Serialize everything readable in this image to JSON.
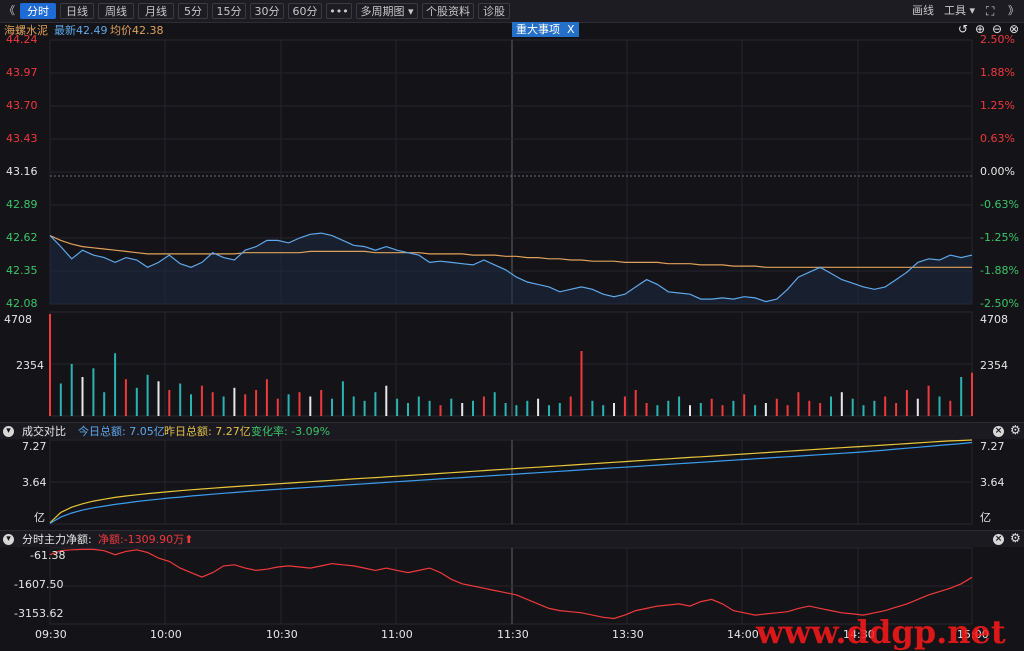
{
  "toolbar": {
    "nav_back": "《",
    "nav_forward": "》",
    "tabs": [
      "分时",
      "日线",
      "周线",
      "月线",
      "5分",
      "15分",
      "30分",
      "60分",
      "•••",
      "多周期图",
      "个股资料",
      "诊股"
    ],
    "active_tab": "分时",
    "draw_label": "画线",
    "tools_label": "工具"
  },
  "stock": {
    "name": "海螺水泥",
    "latest_label": "最新42.49",
    "avg_label": "均价42.38",
    "event_label": "重大事项",
    "event_close": "X"
  },
  "price_axis": {
    "left": [
      "44.24",
      "43.97",
      "43.70",
      "43.43",
      "43.16",
      "42.89",
      "42.62",
      "42.35",
      "42.08"
    ],
    "right": [
      "2.50%",
      "1.88%",
      "1.25%",
      "0.63%",
      "0.00%",
      "-0.63%",
      "-1.25%",
      "-1.88%",
      "-2.50%"
    ]
  },
  "volume_axis": {
    "top": "4708",
    "mid": "2354"
  },
  "turnover_panel": {
    "title": "成交对比",
    "today_label": "今日总额: 7.05亿",
    "yesterday_label": "昨日总额: 7.27亿",
    "change_label": "变化率: -3.09%",
    "axis": [
      "7.27",
      "3.64",
      "亿"
    ]
  },
  "netflow_panel": {
    "title": "分时主力净额:",
    "net_label": "净额:-1309.90万",
    "axis": [
      "-61.38",
      "-1607.50",
      "-3153.62"
    ]
  },
  "time_axis": [
    "09:30",
    "10:00",
    "10:30",
    "11:00",
    "11:30",
    "13:30",
    "14:00",
    "14:30",
    "15:00"
  ],
  "watermark": "www.ddgp.net",
  "colors": {
    "price_line": "#5fa8ea",
    "avg_line": "#e0a25a",
    "up": "#f0393c",
    "down": "#2bb3b3",
    "today_line": "#3a9ef0",
    "yesterday_line": "#e8c63a",
    "netflow_line": "#f0393c"
  },
  "chart_data": {
    "type": "line",
    "price": {
      "prev_close": 43.16,
      "ylim": [
        42.08,
        44.24
      ],
      "values": [
        42.64,
        42.55,
        42.45,
        42.52,
        42.48,
        42.46,
        42.42,
        42.46,
        42.44,
        42.38,
        42.42,
        42.48,
        42.41,
        42.38,
        42.42,
        42.5,
        42.46,
        42.44,
        42.52,
        42.55,
        42.6,
        42.6,
        42.58,
        42.62,
        42.65,
        42.66,
        42.64,
        42.6,
        42.56,
        42.55,
        42.52,
        42.55,
        42.52,
        42.5,
        42.48,
        42.42,
        42.43,
        42.42,
        42.41,
        42.4,
        42.44,
        42.4,
        42.36,
        42.3,
        42.26,
        42.24,
        42.22,
        42.18,
        42.2,
        42.22,
        42.2,
        42.16,
        42.14,
        42.16,
        42.22,
        42.28,
        42.24,
        42.18,
        42.17,
        42.16,
        42.12,
        42.12,
        42.13,
        42.12,
        42.14,
        42.13,
        42.1,
        42.12,
        42.2,
        42.3,
        42.34,
        42.38,
        42.33,
        42.28,
        42.25,
        42.22,
        42.2,
        42.22,
        42.28,
        42.34,
        42.42,
        42.45,
        42.44,
        42.48,
        42.46,
        42.48
      ],
      "avg": [
        42.64,
        42.6,
        42.57,
        42.55,
        42.54,
        42.53,
        42.52,
        42.51,
        42.5,
        42.49,
        42.49,
        42.49,
        42.49,
        42.49,
        42.49,
        42.49,
        42.49,
        42.49,
        42.5,
        42.5,
        42.5,
        42.5,
        42.5,
        42.5,
        42.51,
        42.51,
        42.51,
        42.51,
        42.51,
        42.51,
        42.5,
        42.5,
        42.5,
        42.5,
        42.5,
        42.49,
        42.49,
        42.49,
        42.49,
        42.48,
        42.48,
        42.48,
        42.47,
        42.47,
        42.46,
        42.46,
        42.45,
        42.45,
        42.44,
        42.44,
        42.43,
        42.43,
        42.43,
        42.42,
        42.42,
        42.42,
        42.42,
        42.41,
        42.41,
        42.41,
        42.4,
        42.4,
        42.4,
        42.39,
        42.39,
        42.39,
        42.38,
        42.38,
        42.38,
        42.38,
        42.38,
        42.38,
        42.38,
        42.38,
        42.38,
        42.38,
        42.38,
        42.38,
        42.38,
        42.38,
        42.38,
        42.38,
        42.38,
        42.38,
        42.38,
        42.38
      ]
    },
    "volume": {
      "ylim": [
        0,
        4708
      ],
      "values": [
        4708,
        1500,
        2400,
        1800,
        2200,
        1100,
        2900,
        1700,
        1300,
        1900,
        1600,
        1200,
        1500,
        1000,
        1400,
        1100,
        900,
        1300,
        1000,
        1200,
        1700,
        800,
        1000,
        1100,
        900,
        1200,
        800,
        1600,
        900,
        700,
        1100,
        1400,
        800,
        600,
        900,
        700,
        500,
        800,
        600,
        700,
        900,
        1100,
        600,
        500,
        700,
        800,
        500,
        600,
        900,
        3000,
        700,
        500,
        600,
        900,
        1200,
        600,
        500,
        700,
        900,
        500,
        600,
        800,
        500,
        700,
        1000,
        500,
        600,
        800,
        500,
        1100,
        700,
        600,
        900,
        1100,
        800,
        500,
        700,
        900,
        600,
        1200,
        800,
        1400,
        900,
        700,
        1800,
        2000
      ]
    },
    "turnover": {
      "ylim": [
        0,
        7.27
      ],
      "today": [
        0.05,
        0.6,
        0.95,
        1.2,
        1.4,
        1.55,
        1.7,
        1.82,
        1.95,
        2.05,
        2.15,
        2.25,
        2.33,
        2.42,
        2.5,
        2.58,
        2.66,
        2.73,
        2.8,
        2.87,
        2.94,
        3.0,
        3.06,
        3.12,
        3.18,
        3.24,
        3.3,
        3.36,
        3.42,
        3.48,
        3.54,
        3.6,
        3.66,
        3.72,
        3.78,
        3.84,
        3.9,
        3.96,
        4.02,
        4.08,
        4.14,
        4.2,
        4.26,
        4.32,
        4.38,
        4.44,
        4.5,
        4.56,
        4.62,
        4.68,
        4.74,
        4.8,
        4.86,
        4.92,
        4.98,
        5.04,
        5.1,
        5.16,
        5.22,
        5.28,
        5.34,
        5.4,
        5.46,
        5.52,
        5.58,
        5.64,
        5.7,
        5.76,
        5.82,
        5.88,
        5.94,
        6.0,
        6.06,
        6.12,
        6.18,
        6.24,
        6.32,
        6.4,
        6.48,
        6.56,
        6.64,
        6.72,
        6.8,
        6.88,
        6.96,
        7.05
      ],
      "yesterday": [
        0.1,
        1.0,
        1.45,
        1.75,
        1.98,
        2.15,
        2.3,
        2.42,
        2.53,
        2.63,
        2.72,
        2.8,
        2.88,
        2.96,
        3.03,
        3.1,
        3.17,
        3.24,
        3.3,
        3.36,
        3.42,
        3.48,
        3.54,
        3.6,
        3.66,
        3.72,
        3.78,
        3.84,
        3.9,
        3.96,
        4.02,
        4.08,
        4.14,
        4.2,
        4.26,
        4.32,
        4.38,
        4.44,
        4.5,
        4.56,
        4.62,
        4.68,
        4.74,
        4.8,
        4.86,
        4.92,
        4.98,
        5.04,
        5.1,
        5.16,
        5.22,
        5.28,
        5.34,
        5.4,
        5.46,
        5.52,
        5.58,
        5.64,
        5.7,
        5.76,
        5.82,
        5.88,
        5.94,
        6.0,
        6.06,
        6.12,
        6.18,
        6.24,
        6.3,
        6.36,
        6.42,
        6.48,
        6.54,
        6.6,
        6.66,
        6.72,
        6.78,
        6.84,
        6.9,
        6.96,
        7.02,
        7.08,
        7.14,
        7.19,
        7.23,
        7.27
      ]
    },
    "netflow": {
      "ylim": [
        -3400,
        0
      ],
      "values": [
        -300,
        -120,
        -80,
        -61,
        -61,
        -120,
        -300,
        -150,
        -80,
        -200,
        -450,
        -600,
        -900,
        -1100,
        -1300,
        -1100,
        -800,
        -750,
        -900,
        -1000,
        -950,
        -850,
        -800,
        -850,
        -900,
        -800,
        -700,
        -750,
        -800,
        -900,
        -1000,
        -900,
        -1000,
        -1100,
        -1000,
        -900,
        -1100,
        -1400,
        -1600,
        -1700,
        -1800,
        -1900,
        -2000,
        -2100,
        -2300,
        -2500,
        -2700,
        -2800,
        -2850,
        -2900,
        -3000,
        -3100,
        -3153,
        -3000,
        -2800,
        -2700,
        -2600,
        -2550,
        -2500,
        -2600,
        -2400,
        -2300,
        -2500,
        -2800,
        -2900,
        -3000,
        -2950,
        -2900,
        -2850,
        -2700,
        -2600,
        -2700,
        -2800,
        -2900,
        -2950,
        -3000,
        -2900,
        -2800,
        -2650,
        -2500,
        -2300,
        -2100,
        -1950,
        -1800,
        -1600,
        -1310
      ]
    }
  }
}
